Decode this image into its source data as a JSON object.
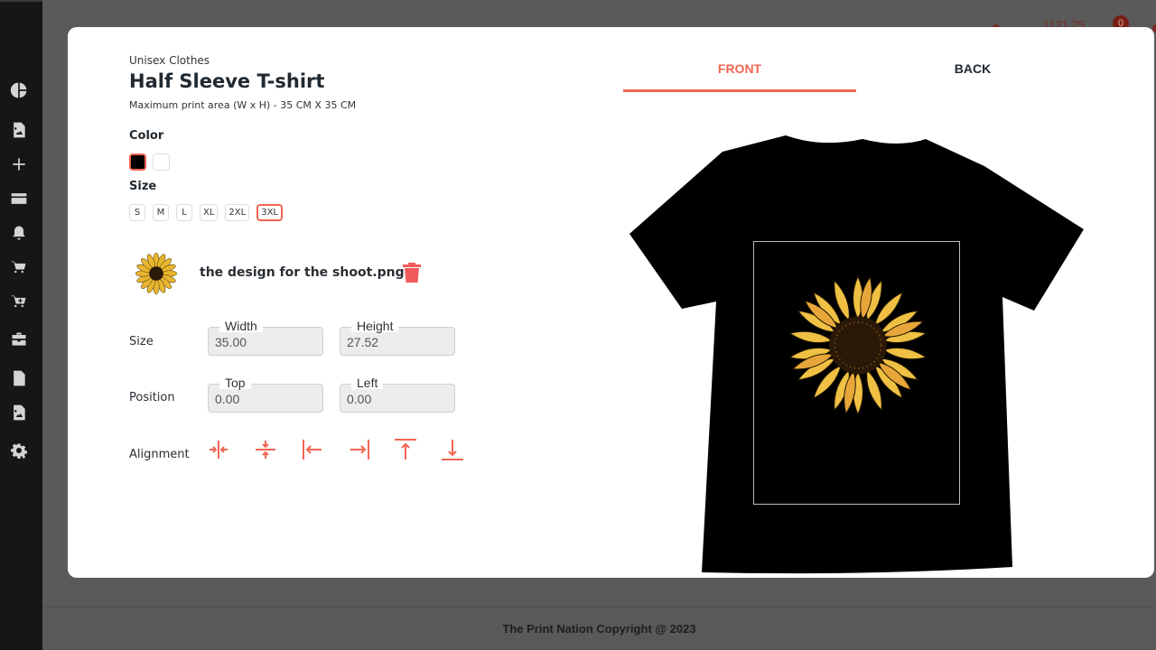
{
  "topbar": {
    "balance": "1121.25",
    "cart_count": "0"
  },
  "sidebar": {
    "items": [
      {
        "icon": "pie-chart-icon"
      },
      {
        "icon": "image-file-icon"
      },
      {
        "icon": "plus-icon"
      },
      {
        "icon": "credit-card-icon"
      },
      {
        "icon": "bell-icon"
      },
      {
        "icon": "cart-icon"
      },
      {
        "icon": "cart-plus-icon"
      },
      {
        "icon": "briefcase-icon"
      },
      {
        "icon": "file-icon"
      },
      {
        "icon": "image-file-icon"
      },
      {
        "icon": "gear-icon"
      }
    ]
  },
  "product": {
    "category": "Unisex Clothes",
    "title": "Half Sleeve T-shirt",
    "print_area": "Maximum print area (W x H) - 35 CM X 35 CM",
    "color_label": "Color",
    "colors": [
      {
        "name": "black",
        "hex": "#000000",
        "selected": true
      },
      {
        "name": "white",
        "hex": "#ffffff",
        "selected": false
      }
    ],
    "size_label": "Size",
    "sizes": [
      "S",
      "M",
      "L",
      "XL",
      "2XL",
      "3XL"
    ],
    "selected_size": "3XL"
  },
  "design": {
    "file_name": "the design for the shoot.png",
    "size_row_label": "Size",
    "width_label": "Width",
    "width_value": "35.00",
    "height_label": "Height",
    "height_value": "27.52",
    "position_row_label": "Position",
    "top_label": "Top",
    "top_value": "0.00",
    "left_label": "Left",
    "left_value": "0.00",
    "alignment_label": "Alignment",
    "alignment_buttons": [
      "align-center-horizontal-icon",
      "align-center-vertical-icon",
      "align-left-icon",
      "align-right-icon",
      "align-top-icon",
      "align-bottom-icon"
    ]
  },
  "preview": {
    "tabs": [
      "FRONT",
      "BACK"
    ],
    "active_tab": "FRONT"
  },
  "colors": {
    "accent": "#f26553",
    "trash": "#f25a5a"
  },
  "footer": {
    "text": "The Print Nation Copyright @ 2023"
  }
}
